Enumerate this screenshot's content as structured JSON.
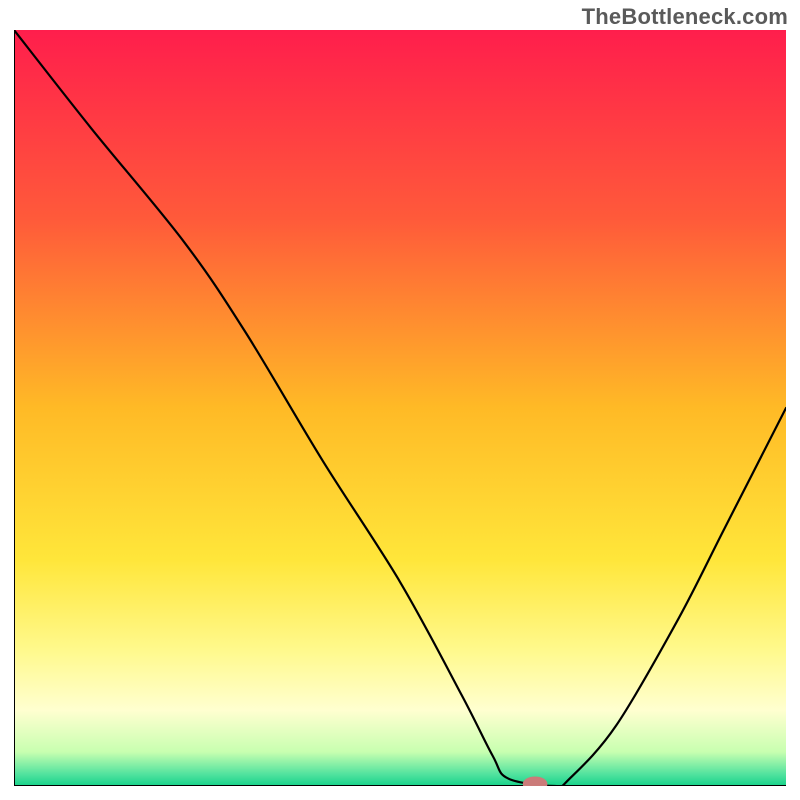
{
  "watermark": "TheBottleneck.com",
  "chart_data": {
    "type": "line",
    "title": "",
    "xlabel": "",
    "ylabel": "",
    "xlim": [
      0,
      100
    ],
    "ylim": [
      0,
      100
    ],
    "grid": false,
    "legend": false,
    "background_gradient": {
      "stops": [
        {
          "offset": 0.0,
          "color": "#ff1e4c"
        },
        {
          "offset": 0.25,
          "color": "#ff5a3a"
        },
        {
          "offset": 0.5,
          "color": "#ffba26"
        },
        {
          "offset": 0.7,
          "color": "#ffe63a"
        },
        {
          "offset": 0.82,
          "color": "#fff98c"
        },
        {
          "offset": 0.9,
          "color": "#ffffd0"
        },
        {
          "offset": 0.955,
          "color": "#c8ffb0"
        },
        {
          "offset": 0.985,
          "color": "#4fe29e"
        },
        {
          "offset": 1.0,
          "color": "#17d28a"
        }
      ]
    },
    "series": [
      {
        "name": "bottleneck-curve",
        "color": "#000000",
        "x": [
          0.0,
          10.0,
          22.0,
          30.0,
          40.0,
          50.0,
          58.0,
          62.0,
          64.0,
          70.0,
          72.0,
          78.0,
          86.0,
          92.0,
          100.0
        ],
        "y": [
          100.0,
          87.0,
          72.0,
          60.0,
          43.0,
          27.0,
          12.0,
          4.0,
          1.0,
          0.0,
          1.0,
          8.0,
          22.0,
          34.0,
          50.0
        ]
      }
    ],
    "marker": {
      "name": "optimal-point",
      "x": 67.5,
      "y": 0.0,
      "color": "#cb7b79",
      "rx": 1.6,
      "ry": 1.0
    },
    "axes": {
      "color": "#000000",
      "thickness": 2
    }
  }
}
